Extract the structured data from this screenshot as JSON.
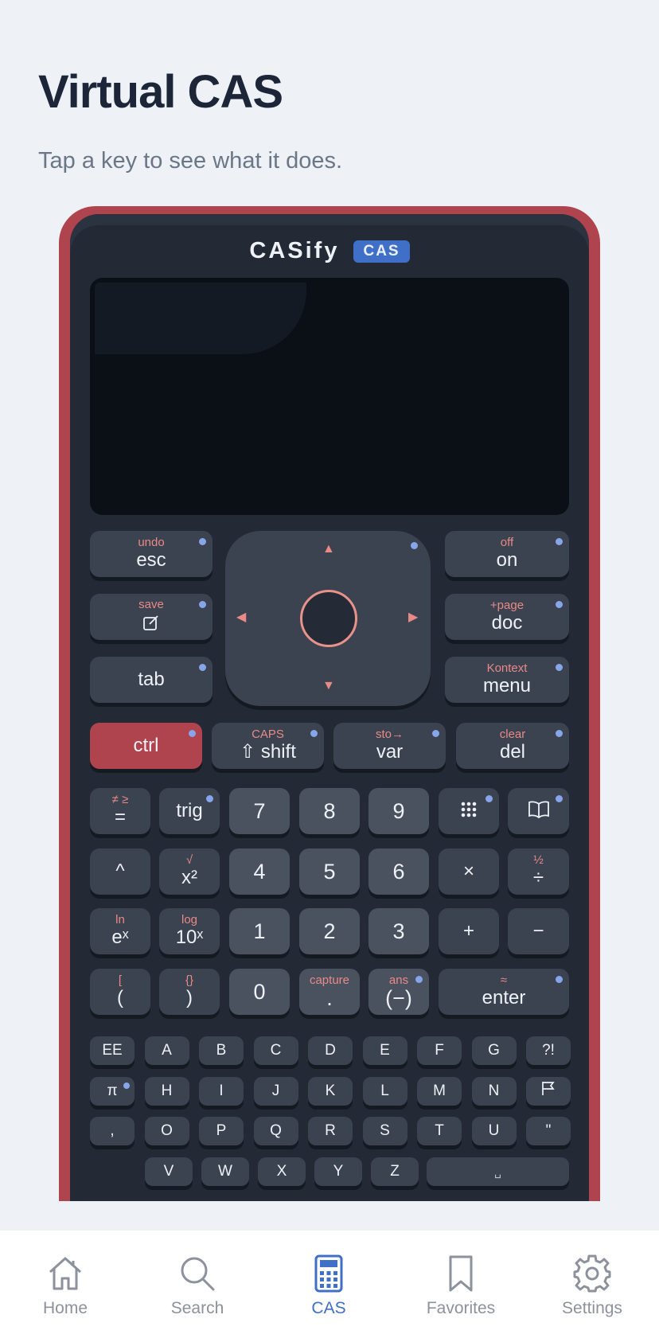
{
  "page": {
    "title": "Virtual CAS",
    "subtitle": "Tap a key to see what it does."
  },
  "calculator": {
    "brand": "CASify",
    "badge": "CAS"
  },
  "keys": {
    "esc": {
      "sec": "undo",
      "pri": "esc"
    },
    "save": {
      "sec": "save"
    },
    "tab": {
      "pri": "tab"
    },
    "on": {
      "sec": "off",
      "pri": "on"
    },
    "doc": {
      "sec": "+page",
      "pri": "doc"
    },
    "menu": {
      "sec": "Kontext",
      "pri": "menu"
    },
    "ctrl": {
      "pri": "ctrl"
    },
    "shift": {
      "sec": "CAPS",
      "pri": "⇧ shift"
    },
    "var": {
      "sec": "sto→",
      "pri": "var"
    },
    "del": {
      "sec": "clear",
      "pri": "del"
    },
    "eq": {
      "sec": "≠ ≥",
      "pri": "="
    },
    "trig": {
      "pri": "trig"
    },
    "caret": {
      "pri": "^"
    },
    "sq": {
      "sec": "√",
      "pri": "x²"
    },
    "mul": {
      "pri": "×"
    },
    "div": {
      "sec": "½",
      "pri": "÷"
    },
    "exp": {
      "sec": "ln",
      "pri": "eˣ"
    },
    "pow10": {
      "sec": "log",
      "pri": "10ˣ"
    },
    "plus": {
      "pri": "+"
    },
    "minus": {
      "pri": "−"
    },
    "lparen": {
      "sec": "[",
      "pri": "("
    },
    "rparen": {
      "sec": "{}",
      "pri": ")"
    },
    "dot": {
      "sec": "capture",
      "pri": "."
    },
    "neg": {
      "sec": "ans",
      "pri": "(−)"
    },
    "enter": {
      "sec": "≈",
      "pri": "enter"
    },
    "n7": "7",
    "n8": "8",
    "n9": "9",
    "n4": "4",
    "n5": "5",
    "n6": "6",
    "n1": "1",
    "n2": "2",
    "n3": "3",
    "n0": "0"
  },
  "alpha_rows": [
    [
      "EE",
      "A",
      "B",
      "C",
      "D",
      "E",
      "F",
      "G",
      "?!"
    ],
    [
      "π",
      "H",
      "I",
      "J",
      "K",
      "L",
      "M",
      "N",
      ""
    ],
    [
      ",",
      "O",
      "P",
      "Q",
      "R",
      "S",
      "T",
      "U",
      "\""
    ],
    [
      "V",
      "W",
      "X",
      "Y",
      "Z",
      "␣"
    ]
  ],
  "nav": {
    "items": [
      {
        "label": "Home",
        "icon": "house-icon"
      },
      {
        "label": "Search",
        "icon": "search-icon"
      },
      {
        "label": "CAS",
        "icon": "calculator-icon",
        "active": true
      },
      {
        "label": "Favorites",
        "icon": "bookmark-icon"
      },
      {
        "label": "Settings",
        "icon": "gear-icon"
      }
    ]
  },
  "colors": {
    "accent": "#3f6fc7",
    "case": "#b0444e",
    "key_secondary": "#e98a86",
    "indicator": "#86a5ea"
  }
}
